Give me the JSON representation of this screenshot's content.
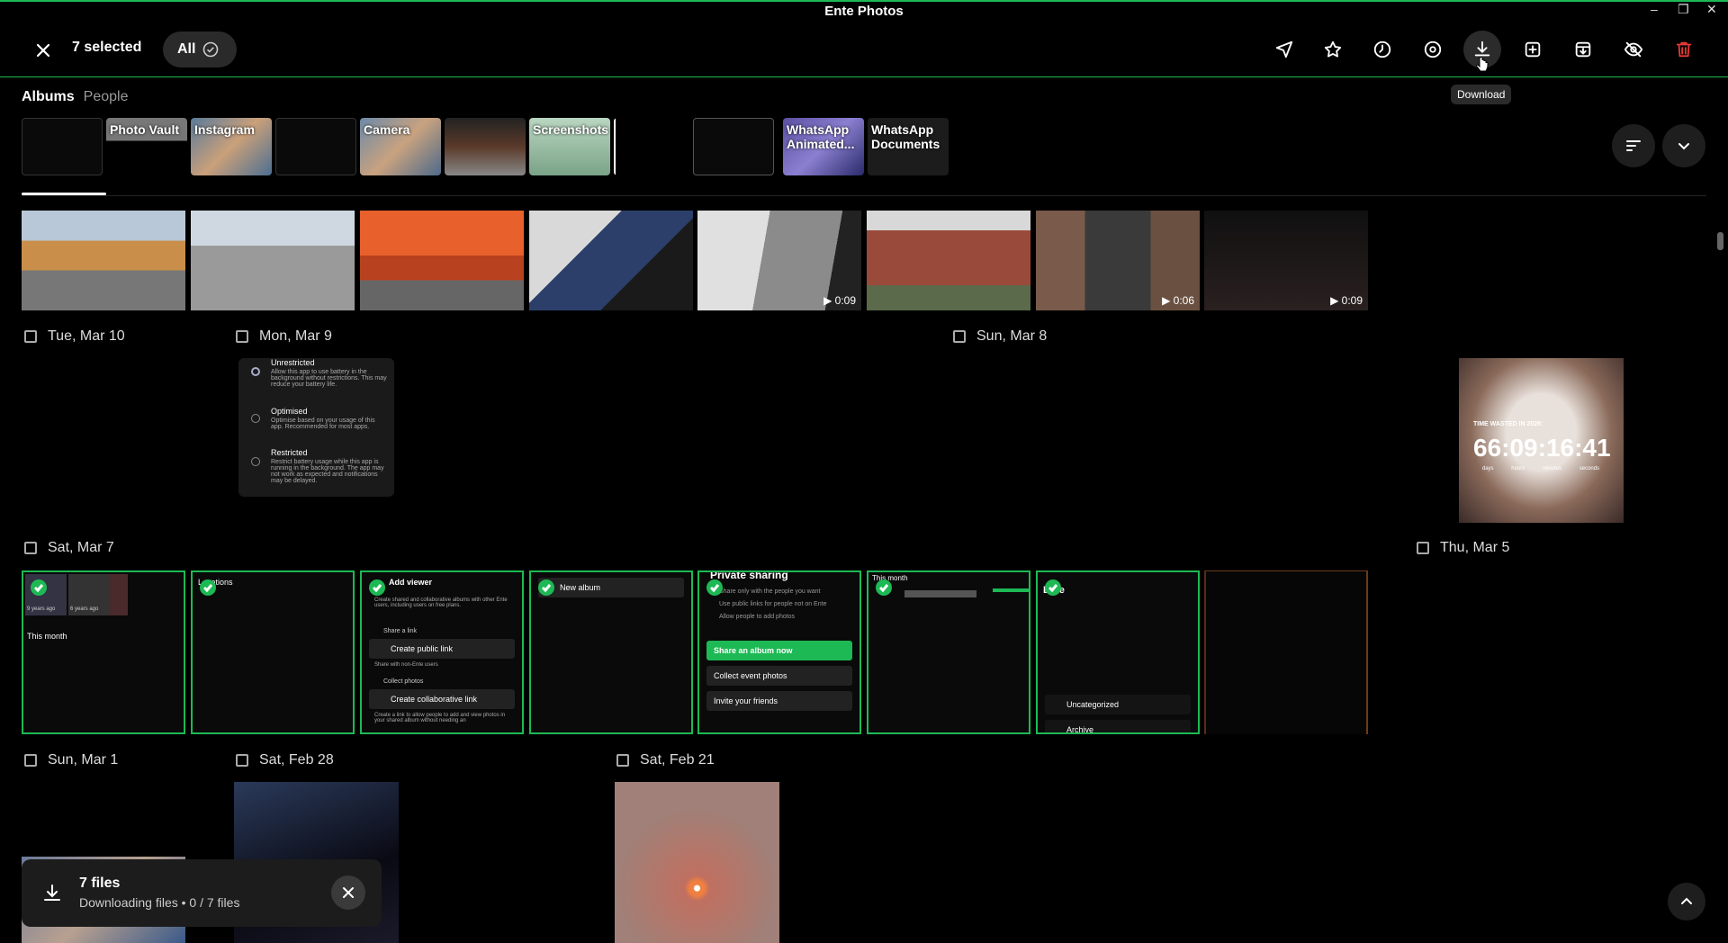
{
  "window": {
    "title": "Ente Photos",
    "controls": [
      "–",
      "❐",
      "✕"
    ]
  },
  "selection": {
    "count_label": "7 selected",
    "all_label": "All"
  },
  "toolbar": {
    "tools": [
      "share-icon",
      "favorite-icon",
      "clock-icon",
      "location-icon",
      "download-icon",
      "add-to-album-icon",
      "archive-icon",
      "hide-icon",
      "delete-icon"
    ],
    "tooltip": "Download",
    "accent": "#1db954",
    "danger": "#e53935"
  },
  "tabs": {
    "albums": "Albums",
    "people": "People"
  },
  "albums": [
    {
      "label": ""
    },
    {
      "label": "Photo Vault"
    },
    {
      "label": "Instagram"
    },
    {
      "label": ""
    },
    {
      "label": "Camera"
    },
    {
      "label": ""
    },
    {
      "label": "Screenshots"
    },
    {
      "label": ""
    },
    {
      "label": ""
    },
    {
      "label": "WhatsApp Animated..."
    },
    {
      "label": "WhatsApp Documents"
    }
  ],
  "top_row": [
    {
      "duration": ""
    },
    {
      "duration": ""
    },
    {
      "duration": ""
    },
    {
      "duration": ""
    },
    {
      "duration": "0:09"
    },
    {
      "duration": ""
    },
    {
      "duration": "0:06"
    },
    {
      "duration": "0:09"
    }
  ],
  "dates": {
    "d1": "Tue, Mar 10",
    "d2": "Mon, Mar 9",
    "d3": "Sun, Mar 8",
    "d4": "Sat, Mar 7",
    "d5": "Thu, Mar 5",
    "d6": "Sun, Mar 1",
    "d7": "Sat, Feb 28",
    "d8": "Sat, Feb 21"
  },
  "battery": {
    "opt1_title": "Unrestricted",
    "opt1_desc": "Allow this app to use battery in the background without restrictions. This may reduce your battery life.",
    "opt2_title": "Optimised",
    "opt2_desc": "Optimise based on your usage of this app. Recommended for most apps.",
    "opt3_title": "Restricted",
    "opt3_desc": "Restrict battery usage while this app is running in the background. The app may not work as expected and notifications may be delayed."
  },
  "timer": {
    "title": "TIME WASTED IN 2026:",
    "value": "66:09:16:41",
    "units": [
      "days",
      "hours",
      "minutes",
      "seconds"
    ]
  },
  "tiles": {
    "t1_a": "9 years ago",
    "t1_b": "6 years ago",
    "t1_month": "This month",
    "t2_title": "Locations",
    "t3_title": "Add viewer",
    "t3_desc": "Create shared and collaborative albums with other Ente users, including users on free plans.",
    "t3_share": "Share a link",
    "t3_public": "Create public link",
    "t3_nonente": "Share with non-Ente users",
    "t3_collect": "Collect photos",
    "t3_collab": "Create collaborative link",
    "t3_foot": "Create a link to allow people to add and view photos in your shared album without needing an",
    "t4_title": "New album",
    "t5_title": "Private sharing",
    "t5_l1": "Share only with the people you want",
    "t5_l2": "Use public links for people not on Ente",
    "t5_l3": "Allow people to add photos",
    "t5_btn1": "Share an album now",
    "t5_btn2": "Collect event photos",
    "t5_btn3": "Invite your friends",
    "t6_title": "This month",
    "t7_title": "Ente",
    "t7_uncat": "Uncategorized",
    "t7_archive": "Archive"
  },
  "toast": {
    "title": "7 files",
    "subtitle": "Downloading files • 0 / 7 files"
  }
}
